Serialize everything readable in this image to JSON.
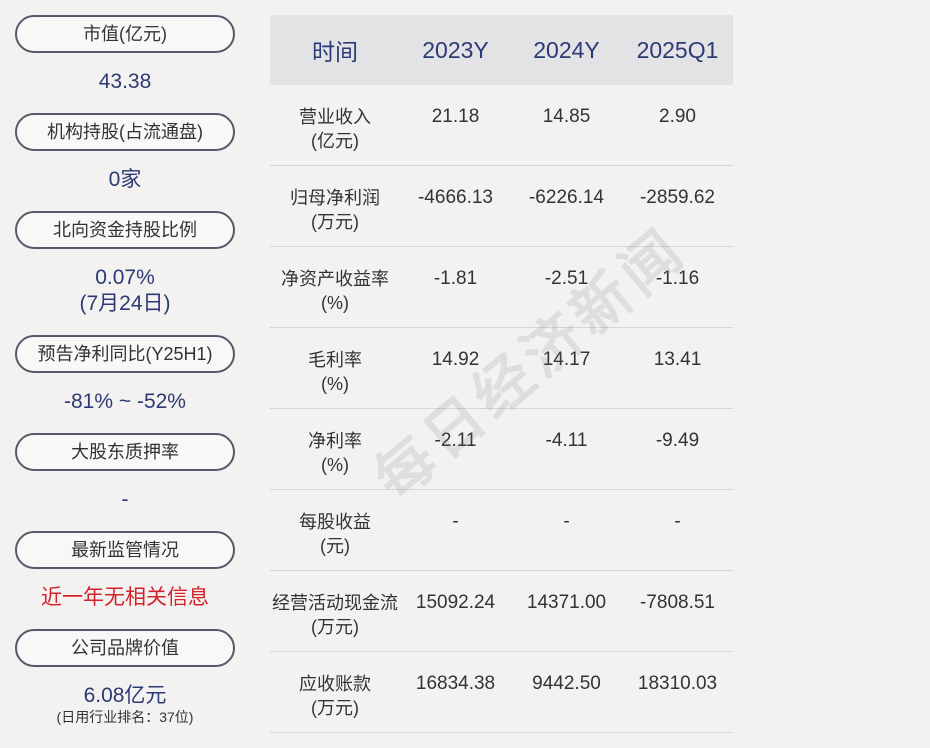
{
  "left": {
    "items": [
      {
        "label": "市值(亿元)",
        "value": "43.38"
      },
      {
        "label": "机构持股(占流通盘)",
        "value": "0家"
      },
      {
        "label": "北向资金持股比例",
        "value": "0.07%",
        "value2": "(7月24日)"
      },
      {
        "label": "预告净利同比(Y25H1)",
        "value": "-81% ~ -52%"
      },
      {
        "label": "大股东质押率",
        "value": "-"
      },
      {
        "label": "最新监管情况",
        "value": "近一年无相关信息"
      },
      {
        "label": "公司品牌价值",
        "value": "6.08亿元",
        "note": "(日用行业排名：37位)"
      }
    ]
  },
  "table": {
    "headers": [
      "时间",
      "2023Y",
      "2024Y",
      "2025Q1"
    ],
    "rows": [
      {
        "name": "营业收入",
        "unit": "(亿元)",
        "v": [
          "21.18",
          "14.85",
          "2.90"
        ]
      },
      {
        "name": "归母净利润",
        "unit": "(万元)",
        "v": [
          "-4666.13",
          "-6226.14",
          "-2859.62"
        ]
      },
      {
        "name": "净资产收益率",
        "unit": "(%)",
        "v": [
          "-1.81",
          "-2.51",
          "-1.16"
        ]
      },
      {
        "name": "毛利率",
        "unit": "(%)",
        "v": [
          "14.92",
          "14.17",
          "13.41"
        ]
      },
      {
        "name": "净利率",
        "unit": "(%)",
        "v": [
          "-2.11",
          "-4.11",
          "-9.49"
        ]
      },
      {
        "name": "每股收益",
        "unit": "(元)",
        "v": [
          "-",
          "-",
          "-"
        ]
      },
      {
        "name": "经营活动现金流",
        "unit": "(万元)",
        "v": [
          "15092.24",
          "14371.00",
          "-7808.51"
        ]
      },
      {
        "name": "应收账款",
        "unit": "(万元)",
        "v": [
          "16834.38",
          "9442.50",
          "18310.03"
        ]
      }
    ]
  },
  "watermark": "每日经济新闻",
  "colors": {
    "value_blue": "#2b3a75",
    "alert_red": "#d4222a",
    "header_bg": "#e3e3e5"
  }
}
